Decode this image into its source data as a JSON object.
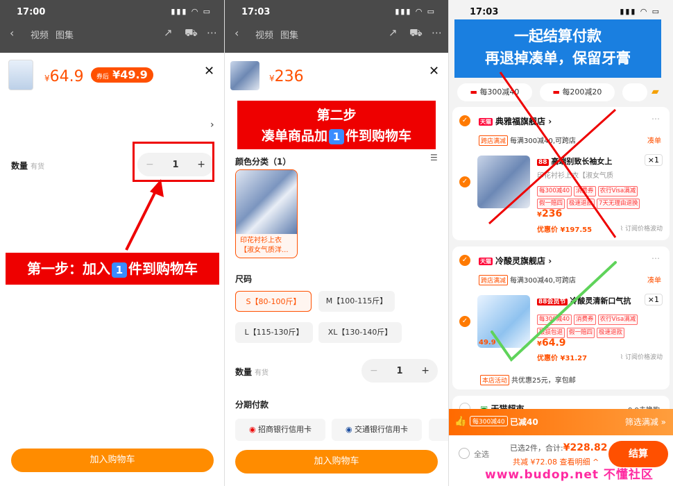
{
  "colors": {
    "accent": "#ff5000",
    "button": "#ff8c00",
    "annotation_red": "#e00000",
    "annotation_blue": "#1a7fe0"
  },
  "p1": {
    "status": {
      "time": "17:00"
    },
    "nav": {
      "tab_video": "视频",
      "tab_gallery": "图集"
    },
    "price": "64.9",
    "currency": "¥",
    "coupon_prefix": "券后",
    "coupon_price": "¥49.9",
    "qty_label": "数量",
    "qty_stock": "有货",
    "qty_minus": "−",
    "qty_value": "1",
    "qty_plus": "+",
    "step1_prefix": "第一步：加入",
    "step1_badge": "1",
    "step1_suffix": "件到购物车",
    "add_cart": "加入购物车"
  },
  "p2": {
    "status": {
      "time": "17:03"
    },
    "nav": {
      "tab_video": "视频",
      "tab_gallery": "图集"
    },
    "price": "236",
    "currency": "¥",
    "step2_line1": "第二步",
    "step2_line2_prefix": "凑单商品加",
    "step2_badge": "1",
    "step2_line2_suffix": "件到购物车",
    "color_label": "颜色分类（1）",
    "color_option": "印花衬衫上衣【淑女气质洋...",
    "size_label": "尺码",
    "sizes": [
      "S【80-100斤】",
      "M【100-115斤】",
      "L【115-130斤】",
      "XL【130-140斤】"
    ],
    "qty_label": "数量",
    "qty_stock": "有货",
    "qty_minus": "−",
    "qty_value": "1",
    "qty_plus": "+",
    "installment_label": "分期付款",
    "banks": [
      "招商银行信用卡",
      "交通银行信用卡"
    ],
    "add_cart": "加入购物车"
  },
  "p3": {
    "status": {
      "time": "17:03"
    },
    "banner_line1": "一起结算付款",
    "banner_line2": "再退掉凑单，保留牙膏",
    "filters": [
      "每300减40",
      "每200减20"
    ],
    "store1": {
      "badge": "天猫",
      "name": "典雅福旗舰店",
      "promo_tag": "跨店满减",
      "promo_text": "每满300减40,可跨店",
      "promo_link": "凑单",
      "item_tag": "88",
      "item_title": "高端别致长袖女上",
      "item_sku": "印花衬衫上衣【淑女气质",
      "tags_row1": [
        "每300减40",
        "消费券",
        "农行Visa满减"
      ],
      "tags_row2": [
        "假一赔四",
        "极速退款",
        "7天无理由退换"
      ],
      "price": "236",
      "price_after": "优惠价 ¥197.55",
      "watch": "订阅价格波动",
      "qty": "×1"
    },
    "store2": {
      "badge": "天猫",
      "name": "冷酸灵旗舰店",
      "promo_tag": "跨店满减",
      "promo_text": "每满300减40,可跨店",
      "promo_link": "凑单",
      "item_tag": "88会员节",
      "item_title": "冷酸灵清新口气抗",
      "tags_row1": [
        "每300减40",
        "消费券",
        "农行Visa满减"
      ],
      "tags_row2": [
        "破损包退",
        "假一赔四",
        "极速退款"
      ],
      "price": "64.9",
      "price_after": "优惠价 ¥31.27",
      "watch": "订阅价格波动",
      "qty": "×1",
      "footer_tag": "本店活动",
      "footer_text": "共优惠25元，享包邮",
      "img_price": "49.9"
    },
    "store3": {
      "name": "天猫超市",
      "note": "9.9去换购"
    },
    "promo_bar": {
      "tag": "每300减40",
      "text": "已减40",
      "link": "筛选满减 »"
    },
    "footer": {
      "select_all": "全选",
      "selected": "已选2件，合计:",
      "total": "¥228.82",
      "saved": "共减 ¥72.08",
      "detail": "查看明细",
      "checkout": "结算"
    },
    "watermark": "www.budop.net 不懂社区"
  }
}
